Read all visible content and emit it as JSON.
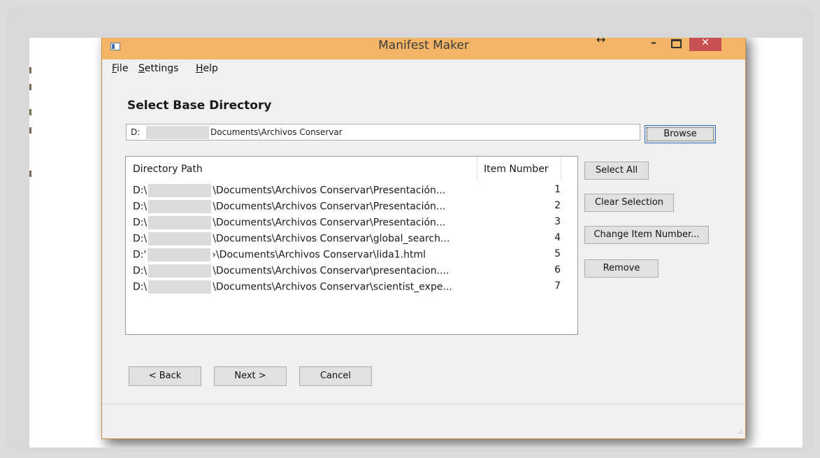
{
  "window": {
    "title": "Manifest Maker",
    "resize_glyph": "↔",
    "minimize_glyph": "–",
    "close_glyph": "✕",
    "colors": {
      "titlebar": "#f4b567",
      "close": "#c75050",
      "focus": "#2f6fbf"
    }
  },
  "menu": {
    "file": {
      "hotkey": "F",
      "rest": "ile"
    },
    "settings": {
      "hotkey": "S",
      "rest": "ettings"
    },
    "help": {
      "hotkey": "H",
      "rest": "elp"
    }
  },
  "base_directory": {
    "heading": "Select Base Directory",
    "value_prefix": "D:",
    "value_suffix": "Documents\\Archivos Conservar",
    "browse_label": "Browse"
  },
  "table": {
    "columns": [
      "Directory Path",
      "Item Number"
    ],
    "rows": [
      {
        "prefix": "D:\\",
        "path": "\\Documents\\Archivos Conservar\\Presentación...",
        "item": "1"
      },
      {
        "prefix": "D:\\",
        "path": "\\Documents\\Archivos Conservar\\Presentación...",
        "item": "2"
      },
      {
        "prefix": "D:\\",
        "path": "\\Documents\\Archivos Conservar\\Presentación...",
        "item": "3"
      },
      {
        "prefix": "D:\\",
        "path": "\\Documents\\Archivos Conservar\\global_search...",
        "item": "4"
      },
      {
        "prefix": "D:'",
        "path": "›\\Documents\\Archivos Conservar\\lida1.html",
        "item": "5"
      },
      {
        "prefix": "D:\\",
        "path": "\\Documents\\Archivos Conservar\\presentacion....",
        "item": "6"
      },
      {
        "prefix": "D:\\",
        "path": "\\Documents\\Archivos Conservar\\scientist_expe...",
        "item": "7"
      }
    ]
  },
  "actions": {
    "select_all": "Select All",
    "clear_selection": "Clear Selection",
    "change_item_number": "Change Item Number...",
    "remove": "Remove"
  },
  "wizard": {
    "back": "< Back",
    "next": "Next >",
    "cancel": "Cancel"
  }
}
